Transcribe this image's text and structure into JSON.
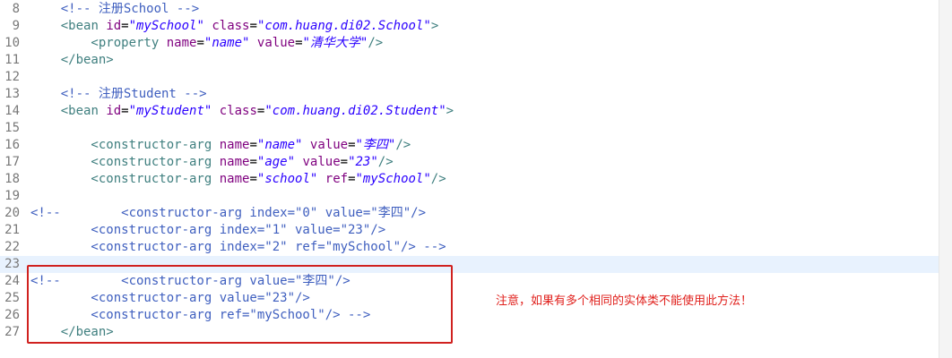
{
  "lines": [
    {
      "n": "8",
      "tokens": [
        {
          "t": "    ",
          "c": "plain"
        },
        {
          "t": "<!-- 注册School -->",
          "c": "comment"
        }
      ]
    },
    {
      "n": "9",
      "tokens": [
        {
          "t": "    <",
          "c": "tag"
        },
        {
          "t": "bean",
          "c": "tag"
        },
        {
          "t": " ",
          "c": "plain"
        },
        {
          "t": "id",
          "c": "attr"
        },
        {
          "t": "=",
          "c": "plain"
        },
        {
          "t": "\"mySchool\"",
          "c": "val"
        },
        {
          "t": " ",
          "c": "plain"
        },
        {
          "t": "class",
          "c": "attr"
        },
        {
          "t": "=",
          "c": "plain"
        },
        {
          "t": "\"com.huang.di02.School\"",
          "c": "val"
        },
        {
          "t": ">",
          "c": "tag"
        }
      ]
    },
    {
      "n": "10",
      "tokens": [
        {
          "t": "        <",
          "c": "tag"
        },
        {
          "t": "property",
          "c": "tag"
        },
        {
          "t": " ",
          "c": "plain"
        },
        {
          "t": "name",
          "c": "attr"
        },
        {
          "t": "=",
          "c": "plain"
        },
        {
          "t": "\"name\"",
          "c": "val"
        },
        {
          "t": " ",
          "c": "plain"
        },
        {
          "t": "value",
          "c": "attr"
        },
        {
          "t": "=",
          "c": "plain"
        },
        {
          "t": "\"清华大学\"",
          "c": "val"
        },
        {
          "t": "/>",
          "c": "tag"
        }
      ]
    },
    {
      "n": "11",
      "tokens": [
        {
          "t": "    </",
          "c": "tag"
        },
        {
          "t": "bean",
          "c": "tag"
        },
        {
          "t": ">",
          "c": "tag"
        }
      ]
    },
    {
      "n": "12",
      "tokens": []
    },
    {
      "n": "13",
      "tokens": [
        {
          "t": "    ",
          "c": "plain"
        },
        {
          "t": "<!-- 注册Student -->",
          "c": "comment"
        }
      ]
    },
    {
      "n": "14",
      "tokens": [
        {
          "t": "    <",
          "c": "tag"
        },
        {
          "t": "bean",
          "c": "tag"
        },
        {
          "t": " ",
          "c": "plain"
        },
        {
          "t": "id",
          "c": "attr"
        },
        {
          "t": "=",
          "c": "plain"
        },
        {
          "t": "\"myStudent\"",
          "c": "val"
        },
        {
          "t": " ",
          "c": "plain"
        },
        {
          "t": "class",
          "c": "attr"
        },
        {
          "t": "=",
          "c": "plain"
        },
        {
          "t": "\"com.huang.di02.Student\"",
          "c": "val"
        },
        {
          "t": ">",
          "c": "tag"
        }
      ]
    },
    {
      "n": "15",
      "tokens": []
    },
    {
      "n": "16",
      "tokens": [
        {
          "t": "        <",
          "c": "tag"
        },
        {
          "t": "constructor-arg",
          "c": "tag"
        },
        {
          "t": " ",
          "c": "plain"
        },
        {
          "t": "name",
          "c": "attr"
        },
        {
          "t": "=",
          "c": "plain"
        },
        {
          "t": "\"name\"",
          "c": "val"
        },
        {
          "t": " ",
          "c": "plain"
        },
        {
          "t": "value",
          "c": "attr"
        },
        {
          "t": "=",
          "c": "plain"
        },
        {
          "t": "\"李四\"",
          "c": "val"
        },
        {
          "t": "/>",
          "c": "tag"
        }
      ]
    },
    {
      "n": "17",
      "tokens": [
        {
          "t": "        <",
          "c": "tag"
        },
        {
          "t": "constructor-arg",
          "c": "tag"
        },
        {
          "t": " ",
          "c": "plain"
        },
        {
          "t": "name",
          "c": "attr"
        },
        {
          "t": "=",
          "c": "plain"
        },
        {
          "t": "\"age\"",
          "c": "val"
        },
        {
          "t": " ",
          "c": "plain"
        },
        {
          "t": "value",
          "c": "attr"
        },
        {
          "t": "=",
          "c": "plain"
        },
        {
          "t": "\"23\"",
          "c": "val"
        },
        {
          "t": "/>",
          "c": "tag"
        }
      ]
    },
    {
      "n": "18",
      "tokens": [
        {
          "t": "        <",
          "c": "tag"
        },
        {
          "t": "constructor-arg",
          "c": "tag"
        },
        {
          "t": " ",
          "c": "plain"
        },
        {
          "t": "name",
          "c": "attr"
        },
        {
          "t": "=",
          "c": "plain"
        },
        {
          "t": "\"school\"",
          "c": "val"
        },
        {
          "t": " ",
          "c": "plain"
        },
        {
          "t": "ref",
          "c": "attr"
        },
        {
          "t": "=",
          "c": "plain"
        },
        {
          "t": "\"mySchool\"",
          "c": "val"
        },
        {
          "t": "/>",
          "c": "tag"
        }
      ]
    },
    {
      "n": "19",
      "tokens": []
    },
    {
      "n": "20",
      "tokens": [
        {
          "t": "<!--        <constructor-arg index=\"0\" value=\"李四\"/>",
          "c": "comment"
        }
      ]
    },
    {
      "n": "21",
      "tokens": [
        {
          "t": "        <constructor-arg index=\"1\" value=\"23\"/>",
          "c": "comment"
        }
      ]
    },
    {
      "n": "22",
      "tokens": [
        {
          "t": "        <constructor-arg index=\"2\" ref=\"mySchool\"/> -->",
          "c": "comment"
        }
      ]
    },
    {
      "n": "23",
      "tokens": [],
      "current": true
    },
    {
      "n": "24",
      "tokens": [
        {
          "t": "<!--        <constructor-arg value=\"李四\"/>",
          "c": "comment"
        }
      ]
    },
    {
      "n": "25",
      "tokens": [
        {
          "t": "        <constructor-arg value=\"23\"/>",
          "c": "comment"
        }
      ]
    },
    {
      "n": "26",
      "tokens": [
        {
          "t": "        <constructor-arg ref=\"mySchool\"/> -->",
          "c": "comment"
        }
      ]
    },
    {
      "n": "27",
      "tokens": [
        {
          "t": "    </",
          "c": "tag"
        },
        {
          "t": "bean",
          "c": "tag"
        },
        {
          "t": ">",
          "c": "tag"
        }
      ]
    }
  ],
  "annotation": {
    "note": "注意，如果有多个相同的实体类不能使用此方法！",
    "box_color": "#d0211f",
    "text_color": "#e0201c"
  },
  "colors": {
    "comment": "#3f5fbf",
    "tag": "#3f7f7f",
    "attr": "#7f007f",
    "value": "#2a00ff",
    "current_line": "#e8f2fe"
  }
}
